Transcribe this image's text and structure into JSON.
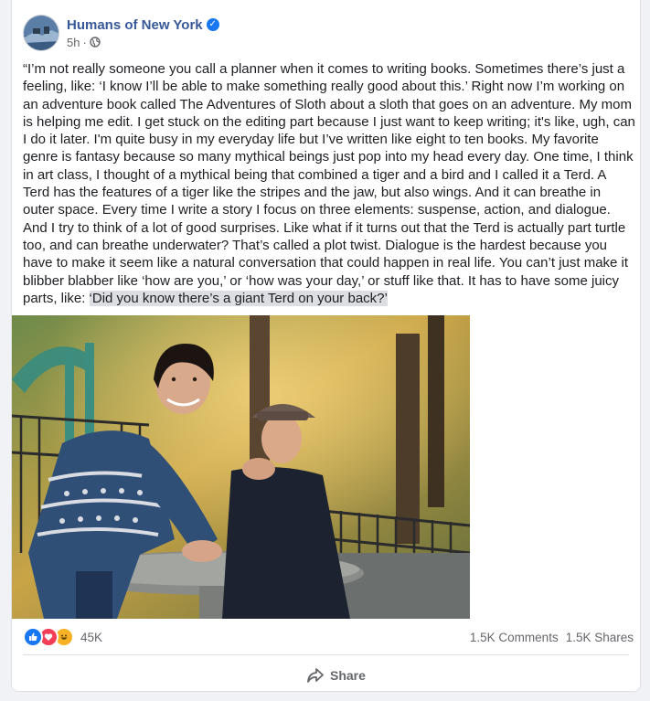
{
  "post": {
    "page_name": "Humans of New York",
    "verified_icon": "verified-badge-icon",
    "timestamp": "5h",
    "separator": "·",
    "privacy_icon": "globe-icon",
    "text_main": "“I’m not really someone you call a planner when it comes to writing books. Sometimes there’s just a feeling, like: ‘I know I’ll be able to make something really good about this.’ Right now I’m working on an adventure book called The Adventures of Sloth about a sloth that goes on an adventure. My mom is helping me edit. I get stuck on the editing part because I just want to keep writing; it's like, ugh, can I do it later. I'm quite busy in my everyday life but I’ve written like eight to ten books. My favorite genre is fantasy because so many mythical beings just pop into my head every day. One time, I think in art class, I thought of a mythical being that combined a tiger and a bird and I called it a Terd. A Terd has the features of a tiger like the stripes and the jaw, but also wings. And it can breathe in outer space. Every time I write a story I focus on three elements: suspense, action, and dialogue. And I try to think of a lot of good surprises. Like what if it turns out that the Terd is actually part turtle too, and can breathe underwater? That’s called a plot twist. Dialogue is the hardest because you have to make it seem like a natural conversation that could happen in real life. You can’t just make it blibber blabber like ‘how are you,’ or ‘how was your day,’ or stuff like that. It has to have some juicy parts, like: ",
    "text_highlight": "‘Did you know there’s a giant Terd on your back?’"
  },
  "engagement": {
    "reaction_icons": [
      "like-icon",
      "love-icon",
      "haha-icon"
    ],
    "reaction_count": "45K",
    "comments": "1.5K Comments",
    "shares": "1.5K Shares"
  },
  "actions": {
    "share_label": "Share",
    "share_icon": "share-arrow-icon"
  },
  "colors": {
    "page_name": "#385898",
    "verified": "#1877f2",
    "like": "#1877f2",
    "love": "#f33e58",
    "haha": "#f7b125",
    "secondary_text": "#65676b"
  }
}
